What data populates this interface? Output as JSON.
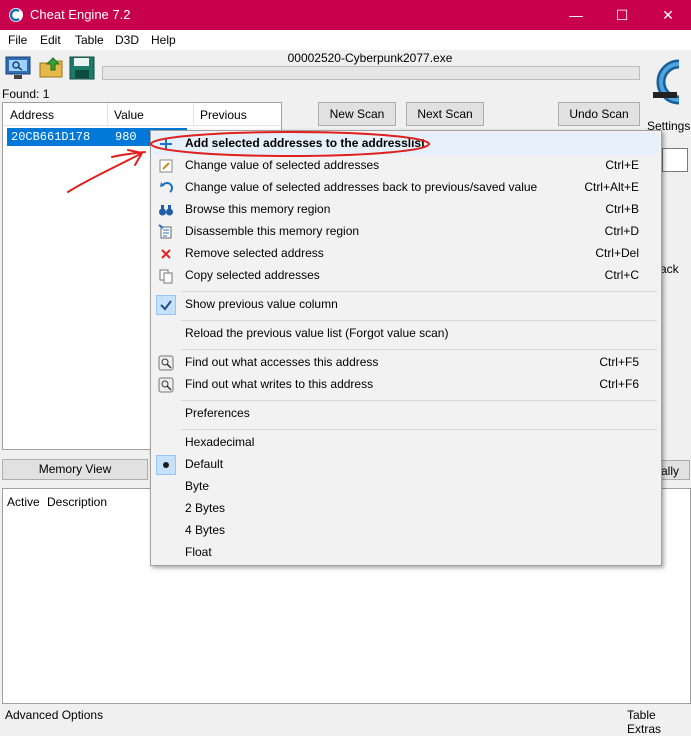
{
  "window": {
    "title": "Cheat Engine 7.2"
  },
  "menu": [
    "File",
    "Edit",
    "Table",
    "D3D",
    "Help"
  ],
  "toolbar": {
    "process": "00002520-Cyberpunk2077.exe"
  },
  "scan": {
    "found": "Found: 1",
    "columns": [
      "Address",
      "Value",
      "Previous"
    ],
    "rows": [
      {
        "address": "20CB661D178",
        "value": "980"
      }
    ],
    "new_scan": "New Scan",
    "next_scan": "Next Scan",
    "undo_scan": "Undo Scan",
    "settings": "Settings",
    "partial_label": "ack",
    "partial_button": "ally"
  },
  "buttons": {
    "memory_view": "Memory View"
  },
  "addresslist": {
    "columns": [
      "Active",
      "Description"
    ]
  },
  "bottom": {
    "advanced": "Advanced Options",
    "extras": "Table Extras"
  },
  "context_menu": {
    "items": [
      {
        "label": "Add selected addresses to the addresslist",
        "shortcut": "",
        "icon": "plus-icon"
      },
      {
        "label": "Change value of selected addresses",
        "shortcut": "Ctrl+E",
        "icon": "edit-icon"
      },
      {
        "label": "Change value of selected addresses back to previous/saved value",
        "shortcut": "Ctrl+Alt+E",
        "icon": "undo-arrow-icon"
      },
      {
        "label": "Browse this memory region",
        "shortcut": "Ctrl+B",
        "icon": "binoculars-icon"
      },
      {
        "label": "Disassemble this memory region",
        "shortcut": "Ctrl+D",
        "icon": "disassemble-icon"
      },
      {
        "label": "Remove selected address",
        "shortcut": "Ctrl+Del",
        "icon": "red-x-icon"
      },
      {
        "label": "Copy selected addresses",
        "shortcut": "Ctrl+C",
        "icon": "copy-icon"
      },
      {
        "label": "Show previous value column",
        "shortcut": "",
        "icon": "checkmark-icon"
      },
      {
        "label": "Reload the previous value list (Forgot value scan)",
        "shortcut": "",
        "icon": ""
      },
      {
        "label": "Find out what accesses this address",
        "shortcut": "Ctrl+F5",
        "icon": "debug-icon"
      },
      {
        "label": "Find out what writes to this address",
        "shortcut": "Ctrl+F6",
        "icon": "debug-icon"
      },
      {
        "label": "Preferences",
        "shortcut": "",
        "icon": ""
      },
      {
        "label": "Hexadecimal",
        "shortcut": "",
        "icon": ""
      },
      {
        "label": "Default",
        "shortcut": "",
        "icon": "radio-dot-icon"
      },
      {
        "label": "Byte",
        "shortcut": "",
        "icon": ""
      },
      {
        "label": "2 Bytes",
        "shortcut": "",
        "icon": ""
      },
      {
        "label": "4 Bytes",
        "shortcut": "",
        "icon": ""
      },
      {
        "label": "Float",
        "shortcut": "",
        "icon": ""
      }
    ]
  },
  "colors": {
    "titlebar": "#c8004c",
    "selection": "#0078d7",
    "annotation": "#e0201c"
  }
}
